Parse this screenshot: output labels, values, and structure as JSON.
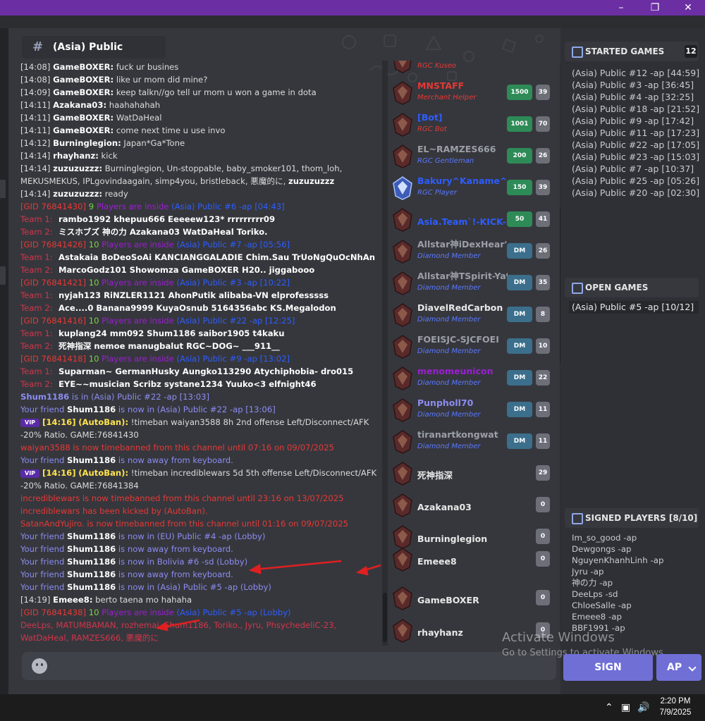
{
  "window": {
    "title": "",
    "min_icon": "minimize-icon",
    "max_icon": "restore-icon",
    "close_icon": "close-icon"
  },
  "channel": {
    "hash": "#",
    "title": "(Asia) Public"
  },
  "log": {
    "l1": {
      "ts": "[14:08]",
      "name": "GameBOXER:",
      "text": " fuck ur busines"
    },
    "l2": {
      "ts": "[14:08]",
      "name": "GameBOXER:",
      "text": " like ur mom did mine?"
    },
    "l3": {
      "ts": "[14:09]",
      "name": "GameBOXER:",
      "text": " keep talkn//go tell ur mom u won a game in dota"
    },
    "l4": {
      "ts": "[14:11]",
      "name": "Azakana03:",
      "text": " haahahahah"
    },
    "l5": {
      "ts": "[14:11]",
      "name": "GameBOXER:",
      "text": " WatDaHeal"
    },
    "l6": {
      "ts": "[14:11]",
      "name": "GameBOXER:",
      "text": " come next time u use invo"
    },
    "l7": {
      "ts": "[14:12]",
      "name": "Burninglegion:",
      "text": " Japan*Ga*Tone"
    },
    "l8": {
      "ts": "[14:14]",
      "name": "rhayhanz:",
      "text": " kick"
    },
    "l9": {
      "ts": "[14:14]",
      "name": "zuzuzuzzz:",
      "text": " Burninglegion, Un-stoppable, baby_smoker101, thom_loh, MEKUSMEKUS, IPLgovindaagain, simp4you, bristleback, 悪魔的に, ",
      "mention": "zuzuzuzzz"
    },
    "l10": {
      "ts": "[14:14]",
      "name": "zuzuzuzzz:",
      "text": " ready"
    },
    "team1_label": "Team 1:",
    "team2_label": "Team 2:",
    "games": [
      {
        "gid": "[GID 76841430]",
        "num": "9",
        "inside": " Players are inside ",
        "room": "(Asia) Public #6 -ap [04:43]",
        "t1": "rambo1992   khepuu666   Eeeeew123*   rrrrrrrrr09",
        "t2": "ミスホブズ   神の力   Azakana03   WatDaHeal   Toriko."
      },
      {
        "gid": "[GID 76841426]",
        "num": "10",
        "inside": " Players are inside ",
        "room": "(Asia) Public #7 -ap [05:56]",
        "t1": "Astakaia   BoDeoSoAi   KANCIANGGALADIE   Chim.Sau   TrUoNgQuOcNhAn",
        "t2": "MarcoGodz101   Showomza   GameBOXER   H20..   jiggabooo"
      },
      {
        "gid": "[GID 76841421]",
        "num": "10",
        "inside": " Players are inside ",
        "room": "(Asia) Public #3 -ap [10:22]",
        "t1": "nyjah123   RiNZLER1121   AhonPutik   alibaba-VN   elprofesssss",
        "t2": "Ace....0   Banana9999   KuyaOsnub   5164356abc   KS.Megalodon"
      },
      {
        "gid": "[GID 76841416]",
        "num": "10",
        "inside": " Players are inside ",
        "room": "(Asia) Public #22 -ap [12:25]",
        "t1": "kuplang24   mm092   Shum1186   saibor1905   t4kaku",
        "t2": "死神指深   nemoe   manugbalut   RGC~DOG~   ___911__"
      },
      {
        "gid": "[GID 76841418]",
        "num": "10",
        "inside": " Players are inside ",
        "room": "(Asia) Public #9 -ap [13:02]",
        "t1": "Suparman~   GermanHusky   Aungko113290   Atychiphobia-   dro015",
        "t2": "EYE~~musician   Scribz   systane1234   Yuuko<3   elfnight46"
      }
    ],
    "shum_in": {
      "name": "Shum1186",
      "text": " is in (Asia) Public #22 -ap [13:03]"
    },
    "friend_prefix": "Your friend ",
    "friend_name": "Shum1186",
    "f1": " is now in (Asia) Public #22 -ap [13:06]",
    "vip": "VIP",
    "ab1": {
      "ts": "[14:16]",
      "name": "(AutoBan):",
      "text": " !timeban waiyan3588 8h 2nd offense Left/Disconnect/AFK -20% Ratio. GAME:76841430"
    },
    "ban1": "waiyan3588 is now timebanned from this channel until 07:16 on 09/07/2025",
    "f2": " is now away from keyboard.",
    "ab2": {
      "ts": "[14:16]",
      "name": "(AutoBan):",
      "text": " !timeban incrediblewars 5d 5th offense Left/Disconnect/AFK -20% Ratio. GAME:76841384"
    },
    "ban2": "incrediblewars is now timebanned from this channel until 23:16 on 13/07/2025",
    "kick": "incrediblewars has been kicked by (AutoBan).",
    "ban3": "SatanAndYujiro. is now timebanned from this channel until 01:16 on 09/07/2025",
    "f3": " is now in (EU) Public #4 -ap (Lobby)",
    "f4": " is now away from keyboard.",
    "f5": " is now in Bolivia #6 -sd (Lobby)",
    "f6": " is now away from keyboard.",
    "f7": " is now in (Asia) Public #5 -ap (Lobby)",
    "emeee": {
      "ts": "[14:19]",
      "name": "Emeee8:",
      "text": " berto taena mo hahaha"
    },
    "last_game": {
      "gid": "[GID 76841438]",
      "num": "10",
      "inside": " Players are inside ",
      "room": "(Asia) Public #5 -ap (Lobby)"
    },
    "last_players": "DeeLps, MATUMBAMAN, rozhemai, Shum1186, Toriko., Jyru, PhsychedeliC-23, WatDaHeal, RAMZES666, 悪魔的に"
  },
  "players": [
    {
      "name": "",
      "role": "RGC Kuseo",
      "role_color": "#e53935",
      "elo": "",
      "count": "",
      "elo_color": "#2e8b57"
    },
    {
      "name": "MNSTAFF",
      "name_color": "#e53935",
      "role": "Merchant Helper",
      "role_color": "#e53935",
      "elo": "1500",
      "count": "39",
      "elo_color": "#2e8b57"
    },
    {
      "name": "[Bot]",
      "name_color": "#2d5dff",
      "role": "RGC Bot",
      "role_color": "#e53935",
      "elo": "1001",
      "count": "70",
      "elo_color": "#2e8b57"
    },
    {
      "name": "EL~RAMZES666",
      "name_color": "#9aa0a6",
      "role": "RGC Gentleman",
      "role_color": "#5a78ff",
      "elo": "200",
      "count": "26",
      "elo_color": "#2e8b57"
    },
    {
      "name": "Bakury^Kaname^Ma",
      "name_color": "#2d5dff",
      "role": "RGC Player",
      "role_color": "#5a78ff",
      "elo": "150",
      "count": "39",
      "elo_color": "#2e8b57"
    },
    {
      "name": "Asia.Team`!-KICK-!",
      "name_color": "#2d5dff",
      "role": "",
      "role_color": "#5a78ff",
      "elo": "50",
      "count": "41",
      "elo_color": "#2e8b57"
    },
    {
      "name": "Allstar神iDexHear'",
      "name_color": "#9aa0a6",
      "role": "Diamond Member",
      "role_color": "#5a78ff",
      "elo": "DM",
      "count": "26",
      "elo_color": "#3b6f8c"
    },
    {
      "name": "Allstar神TSpirit-Yato",
      "name_color": "#9aa0a6",
      "role": "Diamond Member",
      "role_color": "#5a78ff",
      "elo": "DM",
      "count": "35",
      "elo_color": "#3b6f8c"
    },
    {
      "name": "DiavelRedCarbon",
      "name_color": "#e8e8e8",
      "role": "Diamond Member",
      "role_color": "#5a78ff",
      "elo": "DM",
      "count": "8",
      "elo_color": "#3b6f8c"
    },
    {
      "name": "FOEISJC-SJCFOEI",
      "name_color": "#9aa0a6",
      "role": "Diamond Member",
      "role_color": "#5a78ff",
      "elo": "DM",
      "count": "10",
      "elo_color": "#3b6f8c"
    },
    {
      "name": "menomeunicon",
      "name_color": "#9b1fd1",
      "role": "Diamond Member",
      "role_color": "#5a78ff",
      "elo": "DM",
      "count": "22",
      "elo_color": "#3b6f8c"
    },
    {
      "name": "Punpholl70",
      "name_color": "#8c8cf0",
      "role": "Diamond Member",
      "role_color": "#5a78ff",
      "elo": "DM",
      "count": "11",
      "elo_color": "#3b6f8c"
    },
    {
      "name": "tiranartkongwat",
      "name_color": "#9aa0a6",
      "role": "Diamond Member",
      "role_color": "#5a78ff",
      "elo": "DM",
      "count": "11",
      "elo_color": "#3b6f8c"
    },
    {
      "name": "死神指深",
      "name_color": "#e8e8e8",
      "role": "",
      "role_color": "#5a78ff",
      "elo": "",
      "count": "29",
      "elo_color": "#3b6f8c"
    },
    {
      "name": "Azakana03",
      "name_color": "#e8e8e8",
      "role": "",
      "role_color": "#5a78ff",
      "elo": "",
      "count": "0",
      "elo_color": "#3b6f8c"
    },
    {
      "name": "Burninglegion",
      "name_color": "#e8e8e8",
      "role": "",
      "role_color": "#5a78ff",
      "elo": "",
      "count": "0",
      "elo_color": "#3b6f8c"
    },
    {
      "name": "Emeee8",
      "name_color": "#e8e8e8",
      "role": "",
      "role_color": "#5a78ff",
      "elo": "",
      "count": "0",
      "elo_color": "#3b6f8c"
    },
    {
      "name": "GameBOXER",
      "name_color": "#e8e8e8",
      "role": "",
      "role_color": "#5a78ff",
      "elo": "",
      "count": "0",
      "elo_color": "#3b6f8c"
    },
    {
      "name": "rhayhanz",
      "name_color": "#e8e8e8",
      "role": "",
      "role_color": "#5a78ff",
      "elo": "",
      "count": "0",
      "elo_color": "#3b6f8c"
    }
  ],
  "started": {
    "label": "STARTED GAMES",
    "count": "12",
    "games": [
      "(Asia) Public #12 -ap [44:59]",
      "(Asia) Public #3 -ap [36:45]",
      "(Asia) Public #4 -ap [32:25]",
      "(Asia) Public #18 -ap [21:52]",
      "(Asia) Public #9 -ap [17:42]",
      "(Asia) Public #11 -ap [17:23]",
      "(Asia) Public #22 -ap [17:05]",
      "(Asia) Public #23 -ap [15:03]",
      "(Asia) Public #7 -ap [10:37]",
      "(Asia) Public #25 -ap [05:26]",
      "(Asia) Public #20 -ap [02:30]"
    ]
  },
  "open": {
    "label": "OPEN GAMES",
    "game": "(Asia) Public #5 -ap [10/12]"
  },
  "signed": {
    "label": "SIGNED PLAYERS [8/10]",
    "players": [
      "Im_so_good -ap",
      "Dewgongs -ap",
      "NguyenKhanhLinh -ap",
      "Jyru -ap",
      "神の力 -ap",
      "DeeLps -sd",
      "ChloeSalle -ap",
      "Emeee8 -ap",
      "BBF1991 -ap"
    ]
  },
  "actions": {
    "sign": "SIGN",
    "mode": "AP"
  },
  "watermark": {
    "title": "Activate Windows",
    "subtitle": "Go to Settings to activate Windows."
  },
  "taskbar": {
    "time": "2:20 PM",
    "date": "7/9/2025"
  }
}
